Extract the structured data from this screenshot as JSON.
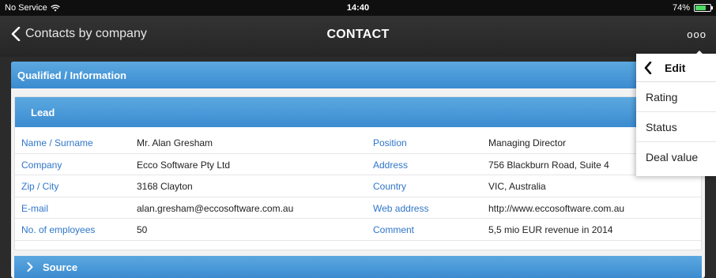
{
  "status_bar": {
    "carrier": "No Service",
    "time": "14:40",
    "battery": "74%",
    "battery_level": 0.74
  },
  "nav": {
    "back_label": "Contacts by company",
    "title": "CONTACT",
    "more_label": "ooo"
  },
  "sections": {
    "qualified_title": "Qualified / Information",
    "lead_title": "Lead",
    "source_title": "Source"
  },
  "fields": [
    {
      "label_left": "Name / Surname",
      "value_left": "Mr. Alan Gresham",
      "label_right": "Position",
      "value_right": "Managing Director"
    },
    {
      "label_left": "Company",
      "value_left": "Ecco Software Pty Ltd",
      "label_right": "Address",
      "value_right": "756 Blackburn Road, Suite 4"
    },
    {
      "label_left": "Zip / City",
      "value_left": "3168 Clayton",
      "label_right": "Country",
      "value_right": "VIC, Australia"
    },
    {
      "label_left": "E-mail",
      "value_left": "alan.gresham@eccosoftware.com.au",
      "label_right": "Web address",
      "value_right": "http://www.eccosoftware.com.au"
    },
    {
      "label_left": "No. of employees",
      "value_left": "50",
      "label_right": "Comment",
      "value_right": "5,5 mio EUR revenue in 2014"
    }
  ],
  "menu": {
    "header": "Edit",
    "items": [
      "Rating",
      "Status",
      "Deal value"
    ]
  },
  "colors": {
    "accent_blue": "#3b8bd0",
    "label_blue": "#2f76c8",
    "battery_green": "#4cd964"
  }
}
